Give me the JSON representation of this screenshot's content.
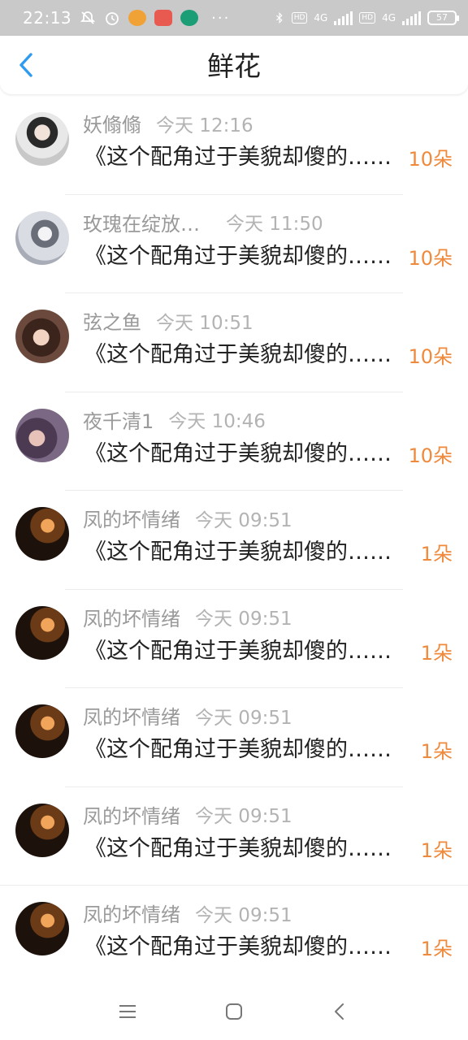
{
  "status_bar": {
    "time": "22:13",
    "dots": "···",
    "net1": "4G",
    "net2": "4G",
    "hd1": "HD",
    "hd2": "HD",
    "battery": "57"
  },
  "header": {
    "back_icon": "chevron-left-icon",
    "title": "鲜花"
  },
  "items": [
    {
      "user": "妖翛翛",
      "time": "今天 12:16",
      "title": "《这个配角过于美貌却傻的……》",
      "count": "10朵"
    },
    {
      "user": "玫瑰在绽放…",
      "time": "今天 11:50",
      "title": "《这个配角过于美貌却傻的……》",
      "count": "10朵"
    },
    {
      "user": "弦之鱼",
      "time": "今天 10:51",
      "title": "《这个配角过于美貌却傻的……》",
      "count": "10朵"
    },
    {
      "user": "夜千清1",
      "time": "今天 10:46",
      "title": "《这个配角过于美貌却傻的……》",
      "count": "10朵"
    },
    {
      "user": "凤的坏情绪",
      "time": "今天 09:51",
      "title": "《这个配角过于美貌却傻的……》",
      "count": "1朵"
    },
    {
      "user": "凤的坏情绪",
      "time": "今天 09:51",
      "title": "《这个配角过于美貌却傻的……》",
      "count": "1朵"
    },
    {
      "user": "凤的坏情绪",
      "time": "今天 09:51",
      "title": "《这个配角过于美貌却傻的……》",
      "count": "1朵"
    },
    {
      "user": "凤的坏情绪",
      "time": "今天 09:51",
      "title": "《这个配角过于美貌却傻的……》",
      "count": "1朵"
    },
    {
      "user": "凤的坏情绪",
      "time": "今天 09:51",
      "title": "《这个配角过于美貌却傻的……》",
      "count": "1朵"
    }
  ],
  "colors": {
    "accent_blue": "#2f9bf0",
    "count_orange": "#ef8a3d",
    "username_gray": "#9a9a9a",
    "status_bar_bg": "#c9c9c9"
  },
  "nav_bar": {
    "menu_icon": "menu-icon",
    "home_icon": "home-square-icon",
    "back_icon": "back-triangle-icon"
  }
}
